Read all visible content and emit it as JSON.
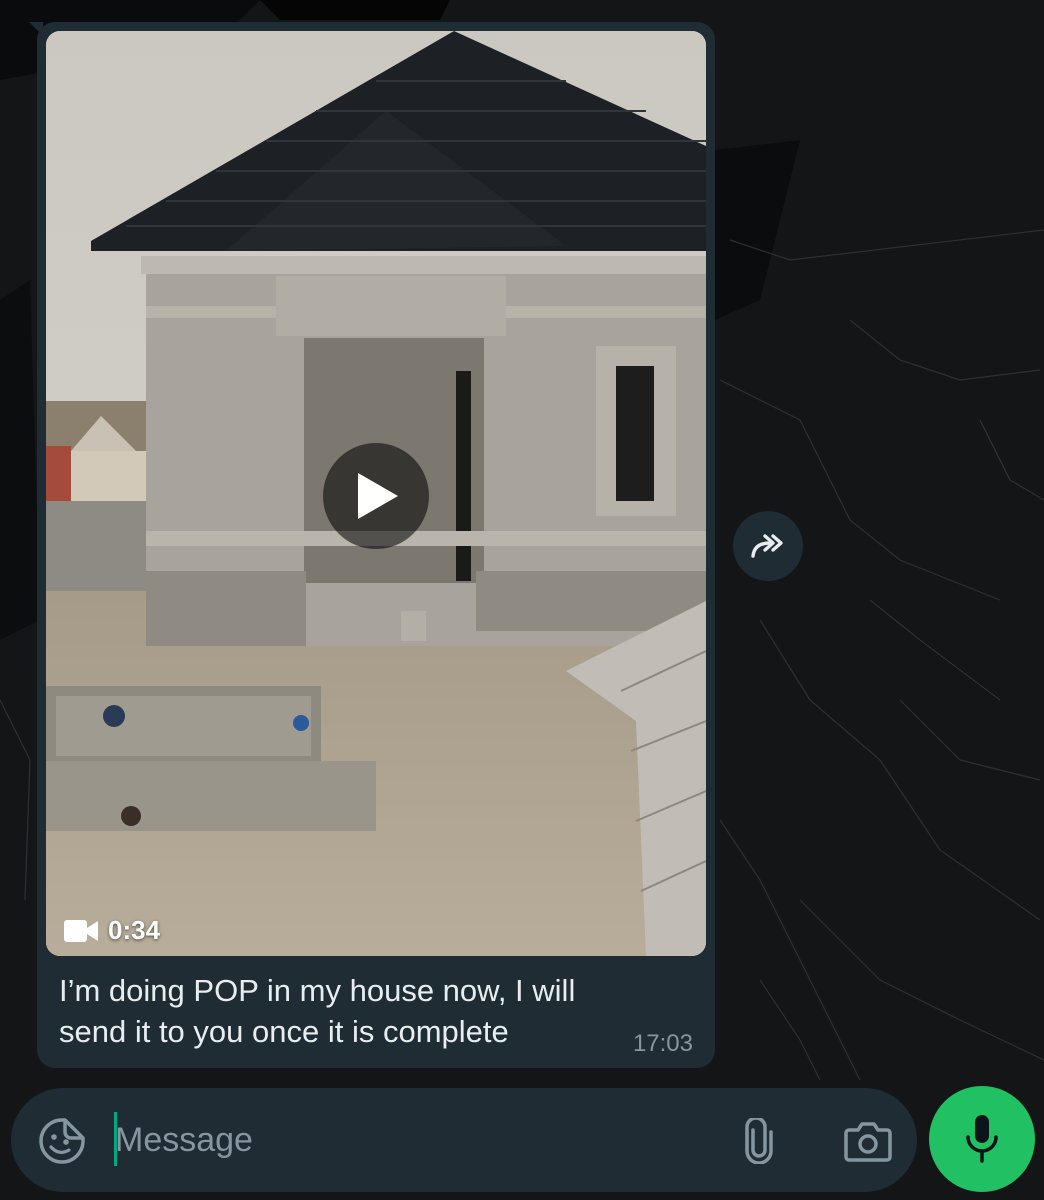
{
  "colors": {
    "background": "#111315",
    "bubble": "#1f2c34",
    "caption_text": "#e9edef",
    "timestamp": "#8696a0",
    "input_cursor": "#00a884",
    "mic_button": "#21c063"
  },
  "message": {
    "media_type": "video",
    "video_icon": "video-camera-icon",
    "duration": "0:34",
    "caption": "I’m doing POP in my house now, I will send it to you once it is complete",
    "time": "17:03"
  },
  "icons": {
    "play": "play-icon",
    "forward": "forward-icon",
    "emoji": "sticker-emoji-icon",
    "attach": "paperclip-icon",
    "camera": "camera-icon",
    "mic": "microphone-icon"
  },
  "composer": {
    "placeholder": "Message",
    "value": ""
  }
}
